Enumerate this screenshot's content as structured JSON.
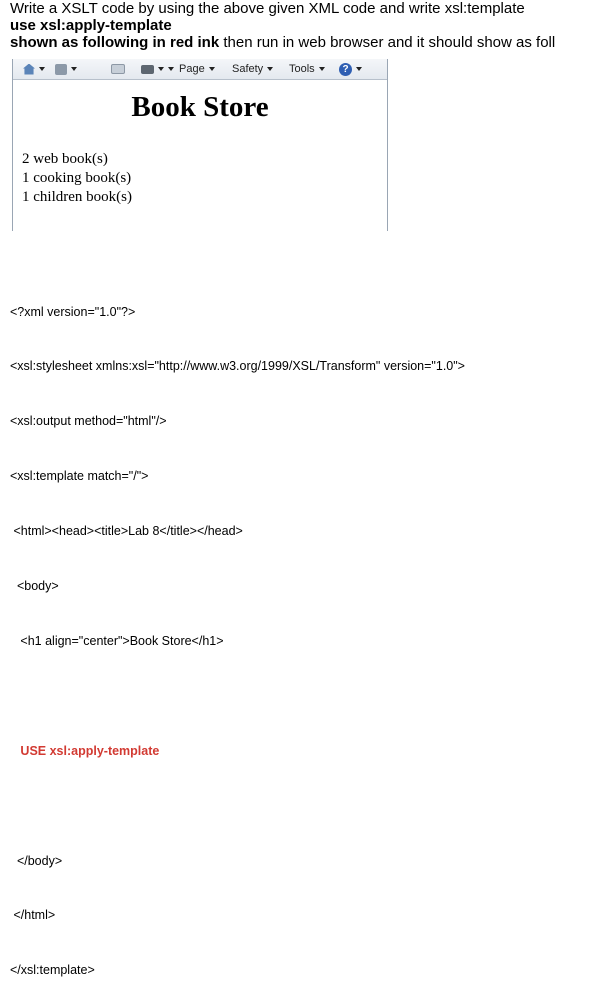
{
  "question": {
    "line1": "Write a XSLT code by using the above given XML code and write xsl:template",
    "line2": "use xsl:apply-template",
    "line3_bold": "shown as following in red ink",
    "line3_rest": " then run in web browser and it should show as foll"
  },
  "browser": {
    "toolbar": {
      "page_label": "Page",
      "safety_label": "Safety",
      "tools_label": "Tools",
      "help_glyph": "?"
    },
    "page_title": "Book Store",
    "books": [
      "2 web book(s)",
      "1 cooking book(s)",
      "1 children book(s)"
    ]
  },
  "code_lines": [
    "<?xml version=\"1.0\"?>",
    "<xsl:stylesheet xmlns:xsl=\"http://www.w3.org/1999/XSL/Transform\" version=\"1.0\">",
    "<xsl:output method=\"html\"/>",
    "<xsl:template match=\"/\">",
    " <html><head><title>Lab 8</title></head>",
    "  <body>",
    "   <h1 align=\"center\">Book Store</h1>",
    "",
    "   USE xsl:apply-template",
    "",
    "  </body>",
    " </html>",
    "</xsl:template>"
  ],
  "colors": {
    "red_ink": "#d23a32"
  }
}
